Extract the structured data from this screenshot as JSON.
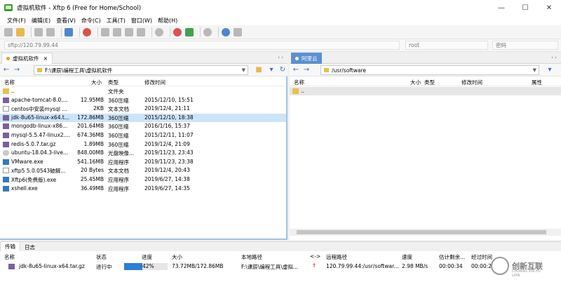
{
  "window": {
    "title": "虚拟机软件 - Xftp 6 (Free for Home/School)",
    "controls": [
      "—",
      "☐",
      "✕"
    ]
  },
  "menu": [
    "文件(F)",
    "编辑(E)",
    "查看(V)",
    "命令(C)",
    "工具(T)",
    "窗口(W)",
    "帮助(H)"
  ],
  "address": {
    "host_placeholder": "sftp://120.79.99.44",
    "user_placeholder": "root",
    "password_placeholder": "密码"
  },
  "left": {
    "tab_label": "虚拟机软件",
    "path": "F:\\课辰\\编程工具\\虚拟机软件",
    "columns": [
      "名称",
      "大小",
      "类型",
      "修改时间"
    ],
    "rows": [
      {
        "name": "..",
        "size": "",
        "type": "文件夹",
        "date": "",
        "icon": "folder"
      },
      {
        "name": "apache-tomcat-8.0....",
        "size": "12.95MB",
        "type": "360压缩",
        "date": "2015/12/10, 15:51",
        "icon": "archive"
      },
      {
        "name": "centos中安装mysql ...",
        "size": "2KB",
        "type": "文本文档",
        "date": "2019/12/4, 21:11",
        "icon": "txt"
      },
      {
        "name": "jdk-8u65-linux-x64.t...",
        "size": "172.86MB",
        "type": "360压缩",
        "date": "2015/12/10, 18:38",
        "icon": "archive"
      },
      {
        "name": "mongodb-linux-x86...",
        "size": "201.64MB",
        "type": "360压缩",
        "date": "2016/1/16, 15:37",
        "icon": "archive"
      },
      {
        "name": "mysql-5.5.47-linux2....",
        "size": "674.36MB",
        "type": "360压缩",
        "date": "2015/12/11, 11:07",
        "icon": "archive"
      },
      {
        "name": "redis-5.0.7.tar.gz",
        "size": "1.89MB",
        "type": "360压缩",
        "date": "2019/12/4, 21:09",
        "icon": "archive"
      },
      {
        "name": "ubuntu-18.04.3-live...",
        "size": "848.00MB",
        "type": "光盘映像...",
        "date": "2019/11/23, 23:43",
        "icon": "disc"
      },
      {
        "name": "VMware.exe",
        "size": "541.16MB",
        "type": "应用程序",
        "date": "2019/11/23, 23:38",
        "icon": "exe"
      },
      {
        "name": "xftp5 5.0.0543破解...",
        "size": "20 Bytes",
        "type": "文本文档",
        "date": "2019/12/4, 20:43",
        "icon": "txt"
      },
      {
        "name": "Xftp6(免费版).exe",
        "size": "25.45MB",
        "type": "应用程序",
        "date": "2019/6/27, 14:38",
        "icon": "exe"
      },
      {
        "name": "xshell.exe",
        "size": "36.49MB",
        "type": "应用程序",
        "date": "2019/6/27, 14:35",
        "icon": "exe"
      }
    ]
  },
  "right": {
    "tab_label": "阿里云",
    "path": "/usr/software",
    "columns": [
      "名称",
      "大小",
      "类型",
      "修改时间",
      "属性"
    ],
    "rows": [
      {
        "name": "..",
        "icon": "folder"
      }
    ]
  },
  "transfer": {
    "tabs": [
      "传输",
      "日志"
    ],
    "columns": [
      "名称",
      "状态",
      "进度",
      "大小",
      "本地路径",
      "<->",
      "远程路径",
      "速度",
      "估计剩余...",
      "经过时间"
    ],
    "row": {
      "name": "jdk-8u65-linux-x64.tar.gz",
      "status": "进行中",
      "progress_label": "42%",
      "progress_fraction": 0.42,
      "size": "73.72MB/172.86MB",
      "local": "F:\\课辰\\编程工具\\虚拟...",
      "dir": "↑",
      "remote": "120.79.99.44:/usr/softwar...",
      "speed": "2.98 MB/s",
      "eta": "00:00:34",
      "elapsed": "00:00:2"
    }
  },
  "watermark": {
    "text": "创新互联",
    "sub": "CHUANG XIN HU LIAN"
  },
  "colors": {
    "accent": "#5a91cf",
    "selection": "#cce4f7",
    "progress": "#2a7fd6"
  }
}
